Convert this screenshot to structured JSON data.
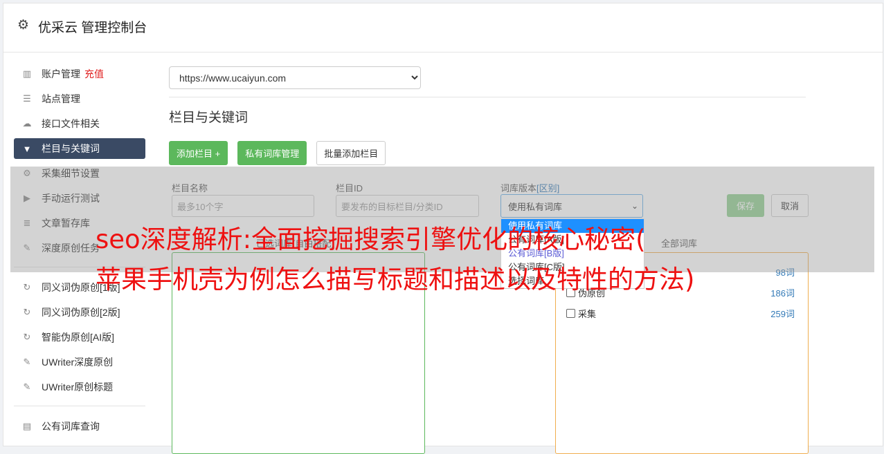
{
  "header": {
    "title": "优采云 管理控制台"
  },
  "sidebar": {
    "items": [
      {
        "label": "账户管理",
        "extra": "充值"
      },
      {
        "label": "站点管理"
      },
      {
        "label": "接口文件相关"
      },
      {
        "label": "栏目与关键词"
      },
      {
        "label": "采集细节设置"
      },
      {
        "label": "手动运行测试"
      },
      {
        "label": "文章暂存库"
      },
      {
        "label": "深度原创任务"
      },
      {
        "label": "同义词伪原创[1版]"
      },
      {
        "label": "同义词伪原创[2版]"
      },
      {
        "label": "智能伪原创[AI版]"
      },
      {
        "label": "UWriter深度原创"
      },
      {
        "label": "UWriter原创标题"
      },
      {
        "label": "公有词库查询"
      }
    ]
  },
  "main": {
    "site_select": "https://www.ucaiyun.com",
    "section_title": "栏目与关键词",
    "buttons": {
      "add": "添加栏目 +",
      "private": "私有词库管理",
      "batch": "批量添加栏目"
    }
  },
  "form": {
    "name_label": "栏目名称",
    "name_placeholder": "最多10个字",
    "id_label": "栏目ID",
    "id_placeholder": "要发布的目标栏目/分类ID",
    "lib_label": "词库版本",
    "lib_link": "[区别]",
    "lib_value": "使用私有词库",
    "save": "保存",
    "cancel": "取消"
  },
  "dropdown": {
    "options": [
      "使用私有词库",
      "公有词库[A版]",
      "公有词库[B版]",
      "公有词库[C版]",
      "选择词库"
    ]
  },
  "panels": {
    "left_head": "已选词库(自由搭配)",
    "right_head": "全部词库",
    "rows": [
      {
        "label": "原创",
        "count": "98词"
      },
      {
        "label": "伪原创",
        "count": "186词"
      },
      {
        "label": "采集",
        "count": "259词"
      }
    ]
  },
  "headline": {
    "line1": "seo深度解析:全面挖掘搜索引擎优化的核心秘密(",
    "line2": "苹果手机壳为例怎么描写标题和描述以及特性的方法)"
  }
}
